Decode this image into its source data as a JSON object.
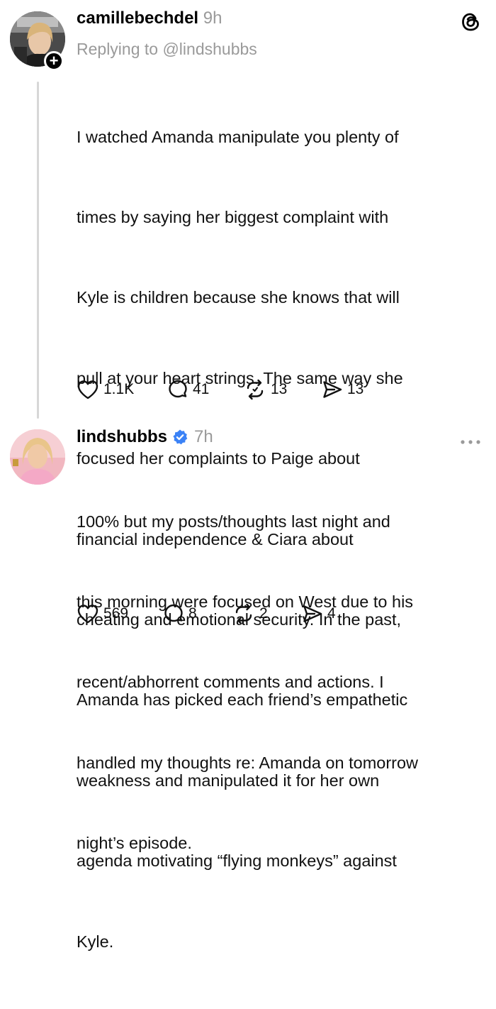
{
  "posts": [
    {
      "username": "camillebechdel",
      "time": "9h",
      "reply_to": "Replying to @lindshubbs",
      "body_lines": [
        "I watched Amanda manipulate you plenty of",
        "times by saying her biggest complaint with",
        "Kyle is children because she knows that will",
        "pull at your heart strings. The same way she",
        "focused her complaints to Paige about",
        "financial  independence & Ciara about",
        "cheating and emotional security. In the past,",
        "Amanda has picked each friend’s empathetic",
        "weakness and manipulated it for her own",
        "agenda motivating “flying monkeys” against",
        "Kyle."
      ],
      "likes": "1.1K",
      "replies": "41",
      "reposts": "13",
      "shares": "13"
    },
    {
      "username": "lindshubbs",
      "time": "7h",
      "body_lines": [
        "100% but my posts/thoughts last night and",
        "this morning were focused on West due to his",
        "recent/abhorrent comments and actions. I",
        "handled my thoughts re: Amanda on tomorrow",
        "night’s episode."
      ],
      "likes": "569",
      "replies": "8",
      "reposts": "2",
      "shares": "4"
    }
  ],
  "colors": {
    "verified": "#3b82f6",
    "muted": "#9a9a9a",
    "thread_line": "#d7d7d7"
  },
  "icons": [
    "threads-logo-icon",
    "heart-icon",
    "comment-icon",
    "repost-icon",
    "share-icon",
    "more-icon",
    "verified-badge-icon",
    "follow-plus-icon"
  ]
}
